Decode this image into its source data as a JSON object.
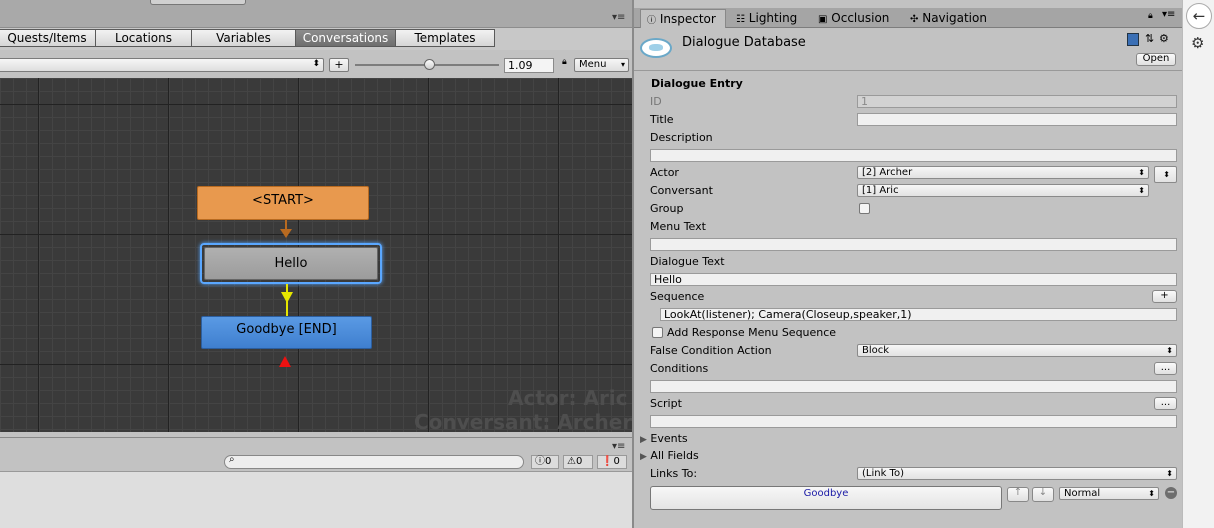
{
  "left": {
    "tabs": [
      "Quests/Items",
      "Locations",
      "Variables",
      "Conversations",
      "Templates"
    ],
    "active_tab": "Conversations",
    "zoom_value": "1.09",
    "add_label": "+",
    "menu_label": "Menu",
    "nodes": {
      "start": "<START>",
      "hello": "Hello",
      "goodbye": "Goodbye [END]"
    },
    "watermark": {
      "actor": "Actor: Aric",
      "conversant": "Conversant: Archer"
    },
    "console": {
      "info_count": "0",
      "warn_count": "0",
      "error_count": "0"
    }
  },
  "inspector": {
    "tabs": [
      "Inspector",
      "Lighting",
      "Occlusion",
      "Navigation"
    ],
    "object_title": "Dialogue Database",
    "open_label": "Open",
    "section_title": "Dialogue Entry",
    "labels": {
      "id": "ID",
      "title": "Title",
      "description": "Description",
      "actor": "Actor",
      "conversant": "Conversant",
      "group": "Group",
      "menu_text": "Menu Text",
      "dialogue_text": "Dialogue Text",
      "sequence": "Sequence",
      "add_response_menu_sequence": "Add Response Menu Sequence",
      "false_condition_action": "False Condition Action",
      "conditions": "Conditions",
      "script": "Script",
      "events": "Events",
      "all_fields": "All Fields",
      "links_to": "Links To:"
    },
    "values": {
      "id": "1",
      "actor": "[2] Archer",
      "conversant": "[1] Aric",
      "dialogue_text": "Hello",
      "sequence": "LookAt(listener); Camera(Closeup,speaker,1)",
      "false_condition_action": "Block",
      "links_to": "(Link To)",
      "link_target": "Goodbye",
      "link_priority": "Normal"
    },
    "buttons": {
      "sequence_add": "+",
      "conditions_more": "...",
      "script_more": "..."
    }
  },
  "colors": {
    "graph_bg": "#3a3a3a",
    "start_node": "#e8994e",
    "hello_node": "#a8a8a8",
    "end_node": "#4f8fdc",
    "selection": "#5aa7ff",
    "link_target_text": "#1a1aa6"
  }
}
